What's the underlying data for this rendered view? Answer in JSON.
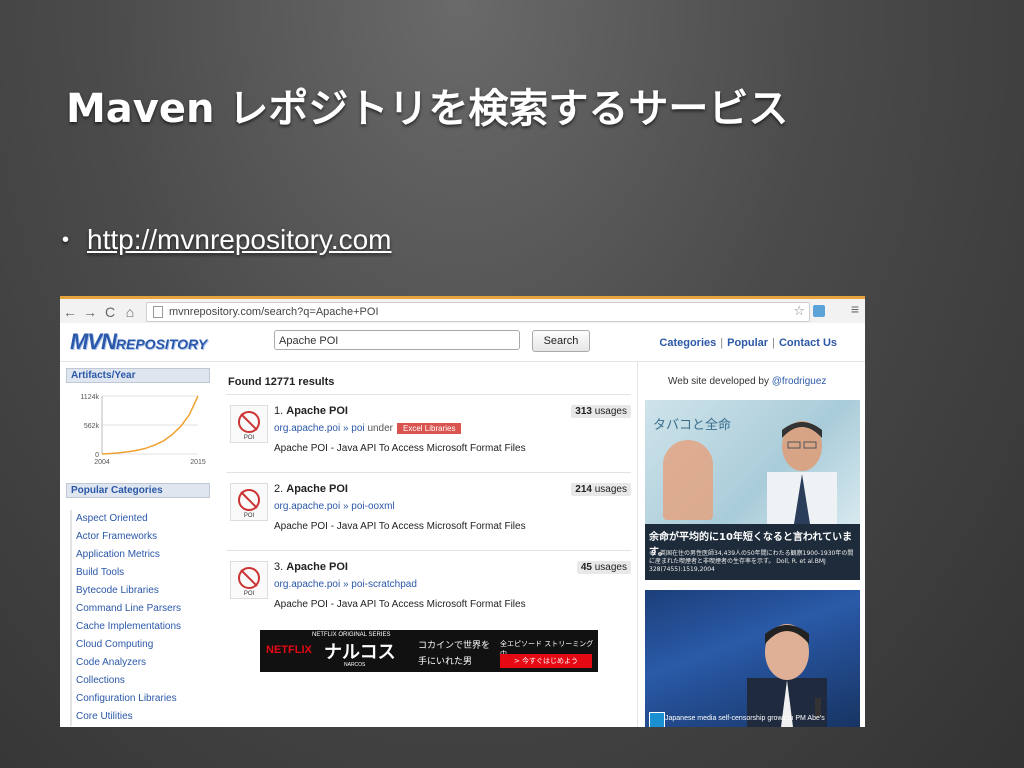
{
  "slide": {
    "title": "Maven レポジトリを検索するサービス",
    "bullet_link": "http://mvnrepository.com"
  },
  "browser": {
    "url": "mvnrepository.com/search?q=Apache+POI",
    "back_icon": "←",
    "forward_icon": "→",
    "reload_icon": "C",
    "home_icon": "⌂",
    "star_icon": "☆",
    "menu_icon": "≡"
  },
  "site": {
    "logo_main": "MVN",
    "logo_rest": "REPOSITORY",
    "search_value": "Apache POI",
    "search_button": "Search",
    "nav_categories": "Categories",
    "nav_popular": "Popular",
    "nav_contact": "Contact Us",
    "nav_sep": "|"
  },
  "sidebar": {
    "artifacts_header": "Artifacts/Year",
    "popular_header": "Popular Categories",
    "categories": [
      "Aspect Oriented",
      "Actor Frameworks",
      "Application Metrics",
      "Build Tools",
      "Bytecode Libraries",
      "Command Line Parsers",
      "Cache Implementations",
      "Cloud Computing",
      "Code Analyzers",
      "Collections",
      "Configuration Libraries",
      "Core Utilities"
    ]
  },
  "chart_data": {
    "type": "area",
    "title": "Artifacts/Year",
    "x_range": [
      2004,
      2015
    ],
    "x_ticks": [
      "2004",
      "2015"
    ],
    "y_ticks": [
      "1124k",
      "562k",
      "0"
    ],
    "ylim": [
      0,
      1124
    ],
    "x": [
      2004,
      2005,
      2006,
      2007,
      2008,
      2009,
      2010,
      2011,
      2012,
      2013,
      2014,
      2015
    ],
    "values": [
      0,
      10,
      25,
      45,
      70,
      110,
      170,
      250,
      370,
      530,
      760,
      1124
    ],
    "grid": true
  },
  "results": {
    "found": "Found 12771 results",
    "items": [
      {
        "number": "1.",
        "name": "Apache POI",
        "usages_count": "313",
        "usages_label": "usages",
        "group": "org.apache.poi",
        "arrow": "»",
        "artifact": "poi",
        "under": "under",
        "tag": "Excel Libraries",
        "description": "Apache POI - Java API To Access Microsoft Format Files"
      },
      {
        "number": "2.",
        "name": "Apache POI",
        "usages_count": "214",
        "usages_label": "usages",
        "group": "org.apache.poi",
        "arrow": "»",
        "artifact": "poi-ooxml",
        "description": "Apache POI - Java API To Access Microsoft Format Files"
      },
      {
        "number": "3.",
        "name": "Apache POI",
        "usages_count": "45",
        "usages_label": "usages",
        "group": "org.apache.poi",
        "arrow": "»",
        "artifact": "poi-scratchpad",
        "description": "Apache POI - Java API To Access Microsoft Format Files"
      }
    ]
  },
  "ad_banner": {
    "netflix": "NETFLIX",
    "series": "NETFLIX ORIGINAL SERIES",
    "show": "ナルコス",
    "show_en": "NARCOS",
    "copy1": "コカインで世界を",
    "copy2": "手にいれた男",
    "copy3": "全エピソード ストリーミング中",
    "cta": "> 今すぐはじめよう"
  },
  "right": {
    "developed_by": "Web site developed by",
    "developer": "@frodriguez",
    "ad1_poster_text": "タバコと全命",
    "ad1_caption": "余命が平均的に10年短くなると言われています。",
    "ad1_note": "※：英国在住の男性医師34,439人の50年間にわたる観察1900-1930年の間に産まれた喫煙者と非喫煙者の生存率を示す。 Doll, R. et al.BMJ 328(7455):1519,2004",
    "ad2_caption": "Japanese media self-censorship grows in PM Abe's"
  },
  "colors": {
    "link": "#2b58a8",
    "tag": "#d9534f",
    "chart_line": "#f0a030",
    "netflix_red": "#e50914"
  }
}
